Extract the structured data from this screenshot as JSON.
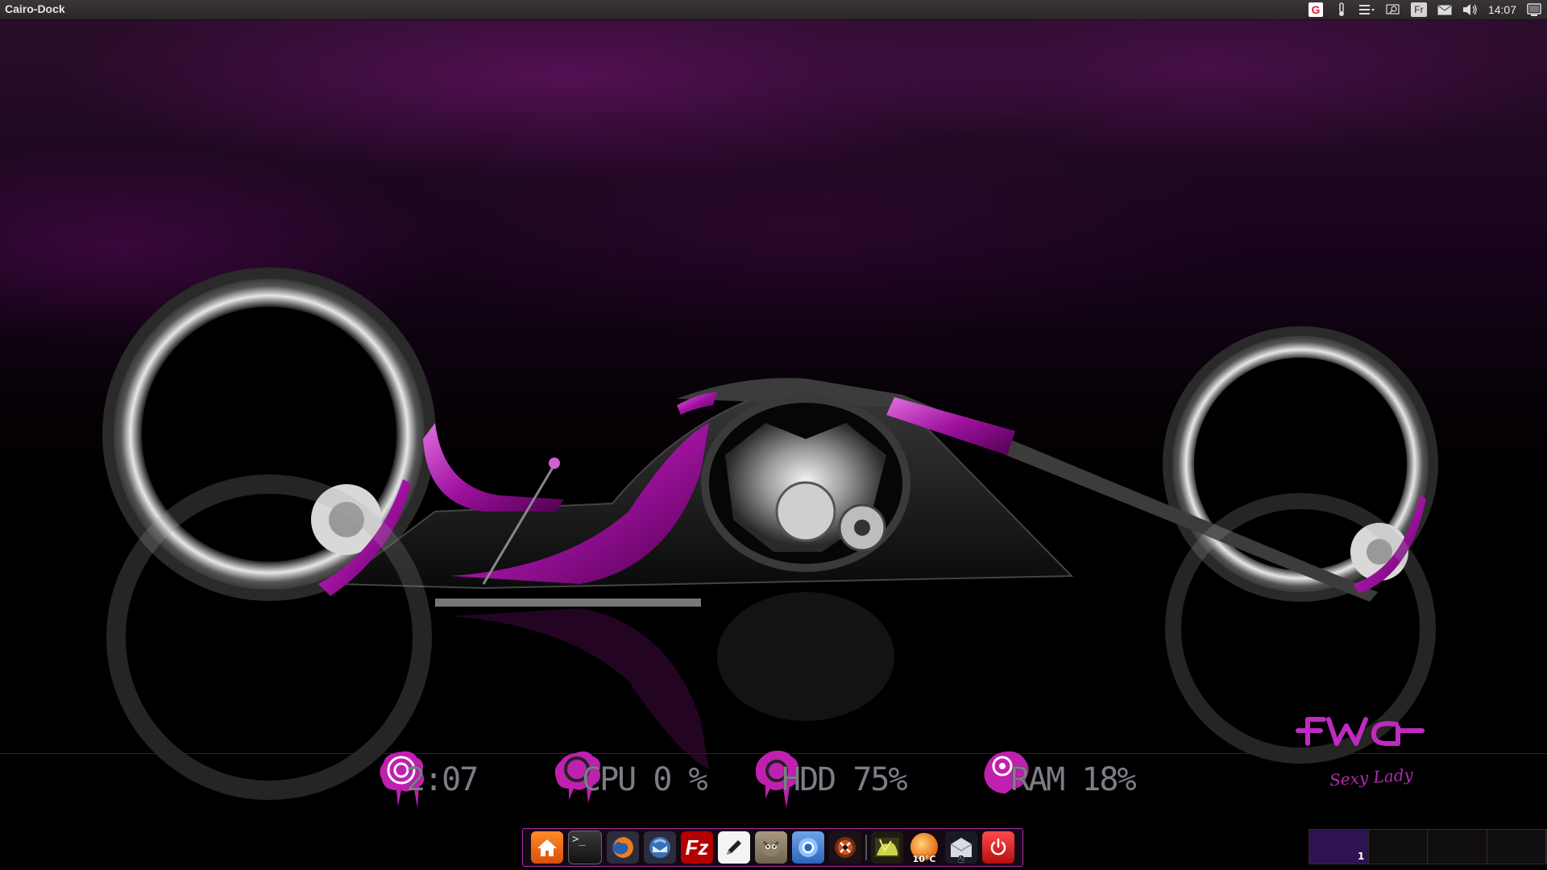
{
  "top_panel": {
    "window_title": "Cairo-Dock",
    "tray_icons": [
      "google-icon",
      "thermometer-icon",
      "menu-icon",
      "search-icon",
      "keyboard-layout-icon",
      "mail-icon",
      "volume-icon",
      "session-icon"
    ],
    "keyboard_layout": "Fr",
    "clock": "14:07"
  },
  "wallpaper": {
    "logo_text": "FWA",
    "logo_tagline": "Sexy Lady"
  },
  "desklets": [
    {
      "name": "clock",
      "text": "2:07"
    },
    {
      "name": "cpu",
      "text": "CPU 0 %"
    },
    {
      "name": "hdd",
      "text": "HDD 75%"
    },
    {
      "name": "ram",
      "text": "RAM 18%"
    }
  ],
  "dock": {
    "items": [
      {
        "name": "home-folder",
        "icon": "home-icon"
      },
      {
        "name": "terminal",
        "icon": "terminal-icon"
      },
      {
        "name": "firefox",
        "icon": "firefox-icon"
      },
      {
        "name": "thunderbird",
        "icon": "thunderbird-icon"
      },
      {
        "name": "filezilla",
        "icon": "filezilla-icon"
      },
      {
        "name": "text-editor",
        "icon": "pencil-icon"
      },
      {
        "name": "gimp",
        "icon": "gimp-icon"
      },
      {
        "name": "chromium",
        "icon": "chromium-icon"
      },
      {
        "name": "media-player",
        "icon": "media-icon"
      },
      {
        "name": "image-viewer",
        "icon": "image-icon"
      },
      {
        "name": "weather",
        "icon": "weather-icon",
        "badge": "10°C"
      },
      {
        "name": "mail",
        "icon": "mail-icon",
        "badge": "2"
      },
      {
        "name": "logout",
        "icon": "power-icon"
      }
    ]
  },
  "workspace_switcher": {
    "current_label": "1",
    "workspace_count": 4,
    "active_index": 0
  },
  "colors": {
    "accent": "#b02ab0",
    "panel_bg": "#2b2729",
    "desklet_text": "#7d7d88"
  }
}
